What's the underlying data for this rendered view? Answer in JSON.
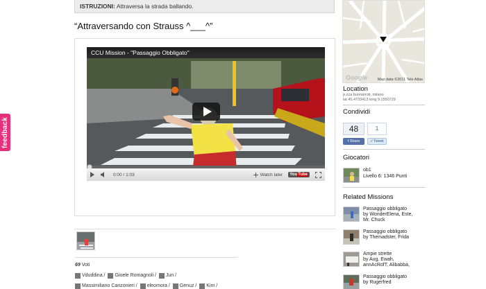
{
  "feedback": {
    "label": "feedback"
  },
  "instructions": {
    "label": "ISTRUZIONI:",
    "text": "Attraversa la strada ballando."
  },
  "mission": {
    "title": "“Attraversando con Strauss ^___^”"
  },
  "video": {
    "title": "CCU Mission - \"Passaggio Obbligato\"",
    "time": "0:00 / 1:03",
    "watch_later": "Watch later",
    "yt_you": "You",
    "yt_tube": "Tube",
    "progress": 0
  },
  "votes": {
    "count": "69",
    "label": "Voti"
  },
  "voters": [
    "Vduddina /",
    "Gioele Romagnoli /",
    "Jun /",
    "Massimiliano Canzonieri /",
    "eleomora /",
    "Genuz /",
    "Kim /"
  ],
  "location": {
    "heading": "Location",
    "address": "p.zza buonarroti, milano",
    "coords": "lat 45.4733413 long 9.1550729",
    "map_credit": "Map data ©2011 Tele Atlas",
    "map_logo": "Google"
  },
  "share": {
    "heading": "Condividi",
    "fb_count": "48",
    "tw_count": "1",
    "fb_label": "Share",
    "tw_label": "Tweet"
  },
  "players": {
    "heading": "Giocatori",
    "items": [
      {
        "name": "ob1",
        "level": "Livello 6: 1346 Punti"
      }
    ]
  },
  "related": {
    "heading": "Related Missions",
    "items": [
      {
        "title": "Passaggio obbligato",
        "by": "by WonderElena, Este,",
        "extra": "Mr. Chuck"
      },
      {
        "title": "Passaggio obbligato",
        "by": "by Themadster, Frida",
        "extra": ""
      },
      {
        "title": "Ampie strette",
        "by": "by Aug, Ewah,",
        "extra": "annAcRofT, Alibabbà,"
      },
      {
        "title": "Passaggio obbligato",
        "by": "by Rugerfred",
        "extra": ""
      }
    ]
  }
}
